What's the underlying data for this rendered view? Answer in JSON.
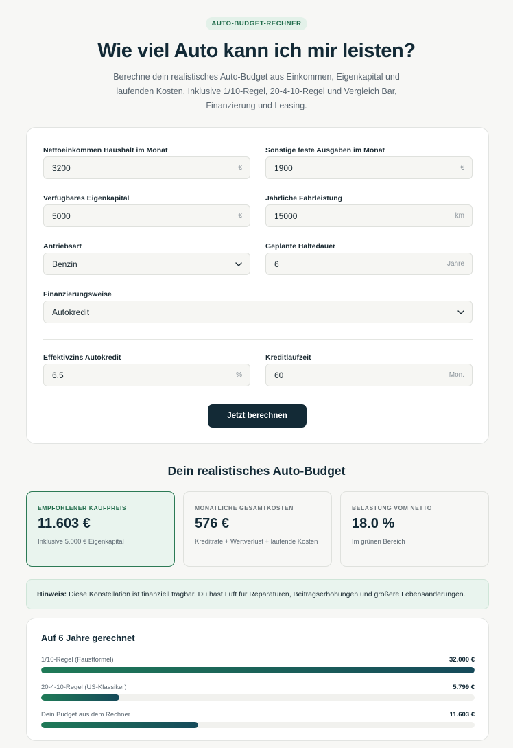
{
  "header": {
    "badge": "AUTO-BUDGET-RECHNER",
    "title": "Wie viel Auto kann ich mir leisten?",
    "subtitle": "Berechne dein realistisches Auto-Budget aus Einkommen, Eigenkapital und laufenden Kosten. Inklusive 1/10-Regel, 20-4-10-Regel und Vergleich Bar, Finanzierung und Leasing."
  },
  "form": {
    "income": {
      "label": "Nettoeinkommen Haushalt im Monat",
      "value": "3200",
      "unit": "€"
    },
    "expenses": {
      "label": "Sonstige feste Ausgaben im Monat",
      "value": "1900",
      "unit": "€"
    },
    "equity": {
      "label": "Verfügbares Eigenkapital",
      "value": "5000",
      "unit": "€"
    },
    "mileage": {
      "label": "Jährliche Fahrleistung",
      "value": "15000",
      "unit": "km"
    },
    "drive": {
      "label": "Antriebsart",
      "value": "Benzin"
    },
    "holding": {
      "label": "Geplante Haltedauer",
      "value": "6",
      "unit": "Jahre"
    },
    "financing": {
      "label": "Finanzierungsweise",
      "value": "Autokredit"
    },
    "interest": {
      "label": "Effektivzins Autokredit",
      "value": "6,5",
      "unit": "%"
    },
    "term": {
      "label": "Kreditlaufzeit",
      "value": "60",
      "unit": "Mon."
    },
    "submit_label": "Jetzt berechnen"
  },
  "results": {
    "title": "Dein realistisches Auto-Budget",
    "cards": [
      {
        "label": "EMPFOHLENER KAUFPREIS",
        "value": "11.603 €",
        "note": "Inklusive 5.000 € Eigenkapital"
      },
      {
        "label": "MONATLICHE GESAMTKOSTEN",
        "value": "576 €",
        "note": "Kreditrate + Wertverlust + laufende Kosten"
      },
      {
        "label": "BELASTUNG VOM NETTO",
        "value": "18.0 %",
        "note": "Im grünen Bereich"
      }
    ],
    "hint_bold": "Hinweis:",
    "hint_text": " Diese Konstellation ist finanziell tragbar. Du hast Luft für Reparaturen, Beitragserhöhungen und größere Lebensänderungen."
  },
  "comparison": {
    "title": "Auf 6 Jahre gerechnet",
    "rows": [
      {
        "label": "1/10-Regel (Faustformel)",
        "value": "32.000 €",
        "fraction": 1.0
      },
      {
        "label": "20-4-10-Regel (US-Klassiker)",
        "value": "5.799 €",
        "fraction": 0.181
      },
      {
        "label": "Dein Budget aus dem Rechner",
        "value": "11.603 €",
        "fraction": 0.363
      }
    ]
  },
  "colors": {
    "accent_dark": "#132a36",
    "accent_green": "#1f7a57",
    "highlight_bg": "#e9f4ee"
  },
  "icons": {
    "select_chevron": "chevron-down-icon"
  }
}
